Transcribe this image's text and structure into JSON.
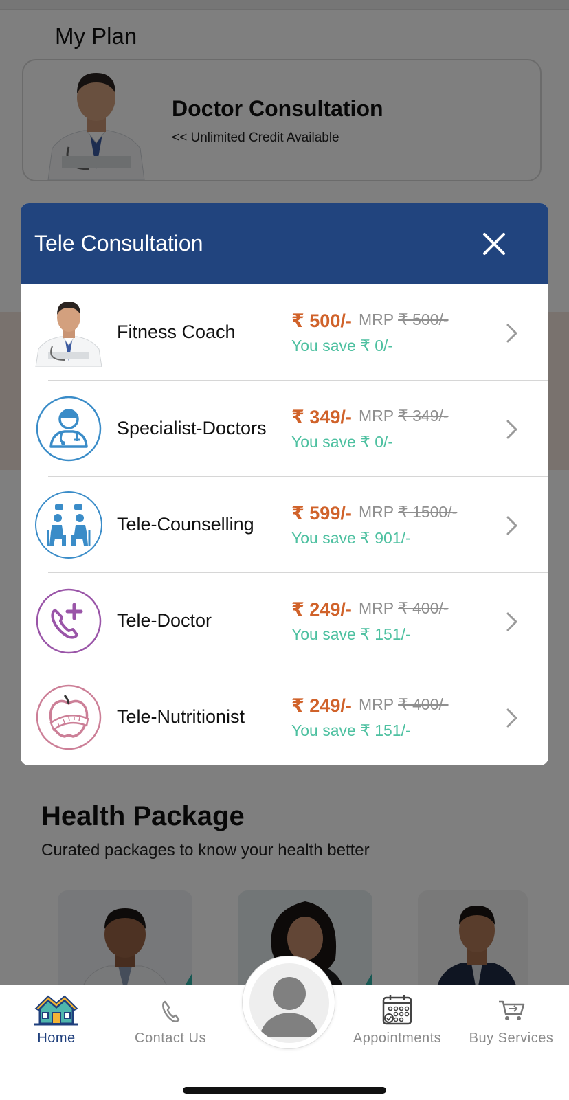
{
  "background": {
    "my_plan_title": "My Plan",
    "plan_card": {
      "title": "Doctor Consultation",
      "subtitle": "<< Unlimited Credit Available"
    },
    "health_package": {
      "title": "Health Package",
      "subtitle": "Curated packages to know your health better"
    }
  },
  "modal": {
    "title": "Tele Consultation",
    "items": [
      {
        "name": "Fitness Coach",
        "price": "₹ 500/-",
        "mrp_label": "MRP",
        "mrp": "₹ 500/-",
        "save": "You save ₹ 0/-",
        "icon": "doctor-photo-icon"
      },
      {
        "name": "Specialist-Doctors",
        "price": "₹ 349/-",
        "mrp_label": "MRP",
        "mrp": "₹ 349/-",
        "save": "You save ₹ 0/-",
        "icon": "specialist-doctor-icon"
      },
      {
        "name": "Tele-Counselling",
        "price": "₹ 599/-",
        "mrp_label": "MRP",
        "mrp": "₹ 1500/-",
        "save": "You save ₹ 901/-",
        "icon": "counselling-icon"
      },
      {
        "name": "Tele-Doctor",
        "price": "₹ 249/-",
        "mrp_label": "MRP",
        "mrp": "₹ 400/-",
        "save": "You save ₹ 151/-",
        "icon": "phone-plus-icon"
      },
      {
        "name": "Tele-Nutritionist",
        "price": "₹ 249/-",
        "mrp_label": "MRP",
        "mrp": "₹ 400/-",
        "save": "You save ₹ 151/-",
        "icon": "apple-tape-icon"
      }
    ]
  },
  "tabbar": {
    "home": "Home",
    "contact": "Contact Us",
    "appointments": "Appointments",
    "buy": "Buy Services"
  },
  "colors": {
    "header_blue": "#21447e",
    "price_orange": "#d0622a",
    "save_green": "#4dc0a0",
    "icon_blue": "#3a8cc8",
    "icon_purple": "#9a55a8",
    "icon_pink": "#cc7f97"
  }
}
